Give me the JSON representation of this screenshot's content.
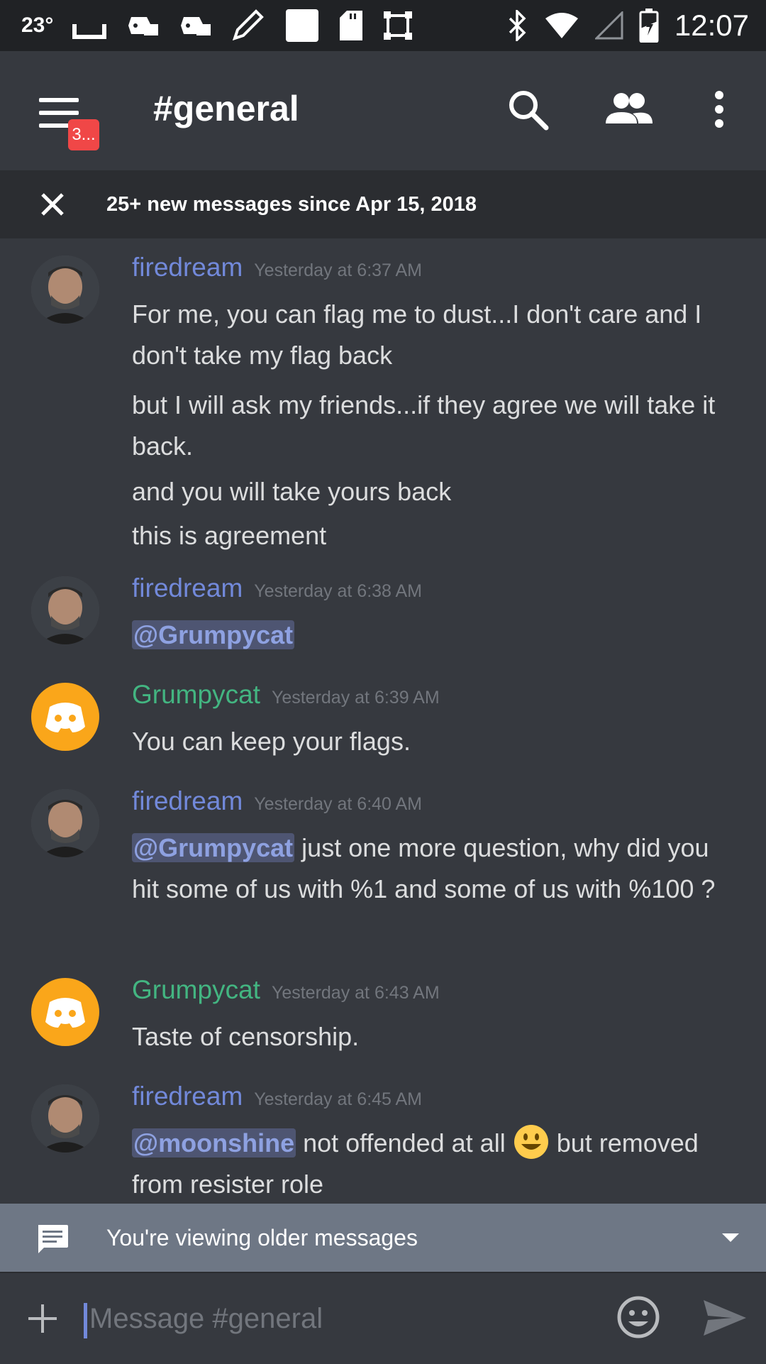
{
  "status_bar": {
    "temperature": "23°",
    "time": "12:07",
    "icons": [
      "cast-icon",
      "gamepad-icon",
      "gamepad-icon",
      "pencil-icon",
      "square-icon",
      "sd-card-icon",
      "screenshot-icon",
      "bluetooth-icon",
      "wifi-icon",
      "cell-signal-icon",
      "battery-icon"
    ]
  },
  "header": {
    "menu_badge": "3...",
    "channel_title": "#general",
    "icons": [
      "search-icon",
      "members-icon",
      "more-vertical-icon"
    ]
  },
  "new_messages_bar": {
    "text": "25+ new messages since Apr 15, 2018"
  },
  "messages": [
    {
      "author": "firedream",
      "author_color": "#7289da",
      "avatar": "user-photo",
      "timestamp": "Yesterday at 6:37 AM",
      "lines": [
        "For me, you can flag me to dust...I don't care and I don't take my flag back",
        "but I will ask my friends...if they agree we will take it back.",
        "and you will take yours back",
        "this is agreement"
      ]
    },
    {
      "author": "firedream",
      "author_color": "#7289da",
      "avatar": "user-photo",
      "timestamp": "Yesterday at 6:38 AM",
      "mention": "@Grumpycat"
    },
    {
      "author": "Grumpycat",
      "author_color": "#43b581",
      "avatar": "discord-default",
      "timestamp": "Yesterday at 6:39 AM",
      "lines": [
        "You can keep your flags."
      ]
    },
    {
      "author": "firedream",
      "author_color": "#7289da",
      "avatar": "user-photo",
      "timestamp": "Yesterday at 6:40 AM",
      "mention": "@Grumpycat",
      "text": " just one more question, why did you hit some of us with %1 and some of us with %100 ?"
    },
    {
      "author": "Grumpycat",
      "author_color": "#43b581",
      "avatar": "discord-default",
      "timestamp": "Yesterday at 6:43 AM",
      "lines": [
        "Taste of censorship."
      ]
    },
    {
      "author": "firedream",
      "author_color": "#7289da",
      "avatar": "user-photo",
      "timestamp": "Yesterday at 6:45 AM",
      "mention": "@moonshine",
      "text_before_emoji": " not offended at all ",
      "emoji": "smiley-emoji",
      "text_after_emoji": " but removed from resister role"
    }
  ],
  "older_messages_bar": {
    "text": "You're viewing older messages"
  },
  "composer": {
    "placeholder": "Message #general"
  },
  "colors": {
    "background": "#36393f",
    "dark_bar": "#2b2d31",
    "status_bar": "#202225",
    "blurple": "#7289da",
    "green": "#43b581",
    "badge_red": "#f04747",
    "discord_avatar": "#faa61a",
    "older_bar": "#6e7785"
  }
}
